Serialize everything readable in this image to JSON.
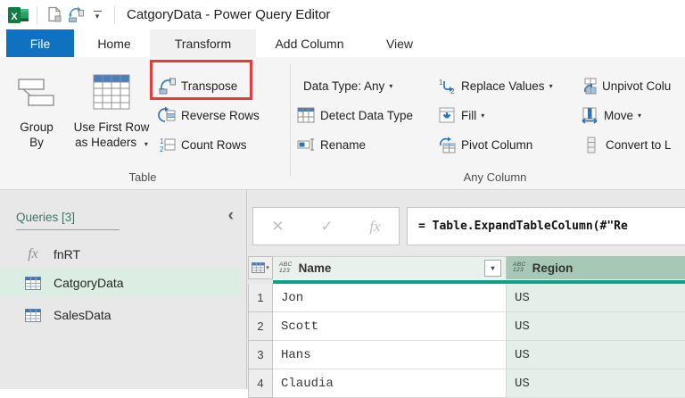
{
  "title_bar": {
    "title": "CatgoryData - Power Query Editor"
  },
  "tabs": [
    {
      "label": "File"
    },
    {
      "label": "Home"
    },
    {
      "label": "Transform"
    },
    {
      "label": "Add Column"
    },
    {
      "label": "View"
    }
  ],
  "active_tab": "Transform",
  "ribbon": {
    "table_group": {
      "label": "Table",
      "group_by": {
        "line1": "Group",
        "line2": "By"
      },
      "use_first_row": {
        "line1": "Use First Row",
        "line2": "as Headers"
      },
      "transpose": "Transpose",
      "reverse_rows": "Reverse Rows",
      "count_rows": "Count Rows"
    },
    "any_column_group": {
      "label": "Any Column",
      "data_type": "Data Type: Any",
      "detect_data_type": "Detect Data Type",
      "rename": "Rename",
      "replace_values": "Replace Values",
      "fill": "Fill",
      "pivot_column": "Pivot Column",
      "unpivot_columns": "Unpivot Colu",
      "move": "Move",
      "convert_to_list": "Convert to L"
    }
  },
  "queries_panel": {
    "header": "Queries [3]",
    "items": [
      {
        "label": "fnRT",
        "icon": "fx-icon",
        "selected": false
      },
      {
        "label": "CatgoryData",
        "icon": "table-icon",
        "selected": true
      },
      {
        "label": "SalesData",
        "icon": "table-icon",
        "selected": false
      }
    ]
  },
  "formula_bar": {
    "formula": "= Table.ExpandTableColumn(#\"Re"
  },
  "grid": {
    "type_icon": {
      "top": "ABC",
      "bottom": "123"
    },
    "columns": [
      {
        "name": "Name",
        "selected": false
      },
      {
        "name": "Region",
        "selected": true
      }
    ],
    "rows": [
      {
        "num": "1",
        "name": "Jon",
        "region": "US"
      },
      {
        "num": "2",
        "name": "Scott",
        "region": "US"
      },
      {
        "num": "3",
        "name": "Hans",
        "region": "US"
      },
      {
        "num": "4",
        "name": "Claudia",
        "region": "US"
      }
    ]
  },
  "glyphs": {
    "dropdown": "▾",
    "collapse": "‹",
    "cancel": "✕",
    "check": "✓",
    "fx": "fx"
  },
  "colors": {
    "file_tab_blue": "#1171c1",
    "icon_blue": "#2e75b6",
    "accent_teal": "#0ba287",
    "annotation_red": "#e23c3c",
    "selected_header_green": "#a6c8b5",
    "selected_cells_green": "#e3efe8",
    "query_selected_green": "#dceee3",
    "queries_header_green": "#3d7668"
  }
}
